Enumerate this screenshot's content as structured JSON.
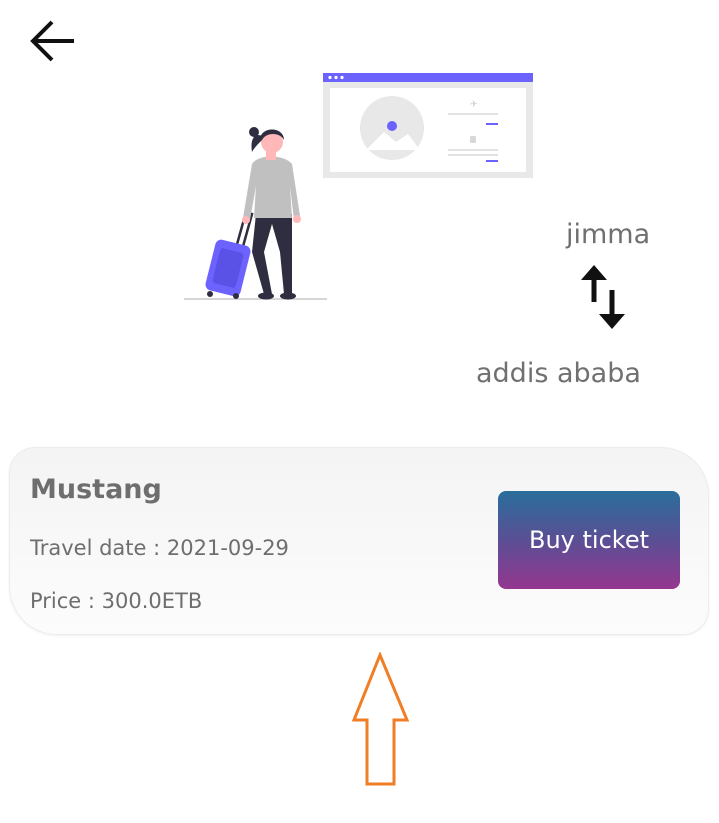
{
  "header": {
    "back_icon": "arrow-left-icon"
  },
  "illustration": {
    "name": "traveler-with-suitcase-illustration",
    "accent_color": "#6c63ff"
  },
  "route": {
    "from": "jimma",
    "to": "addis ababa",
    "swap_icon": "swap-vertical-icon"
  },
  "trip": {
    "bus_name": "Mustang",
    "travel_date": "Travel date : 2021-09-29",
    "price": "Price : 300.0ETB",
    "buy_label": "Buy ticket",
    "buy_gradient": [
      "#2a6e9b",
      "#95378f"
    ]
  },
  "overlay": {
    "arrow_color": "#f07e26",
    "arrow_icon": "arrow-up-outline-icon"
  }
}
